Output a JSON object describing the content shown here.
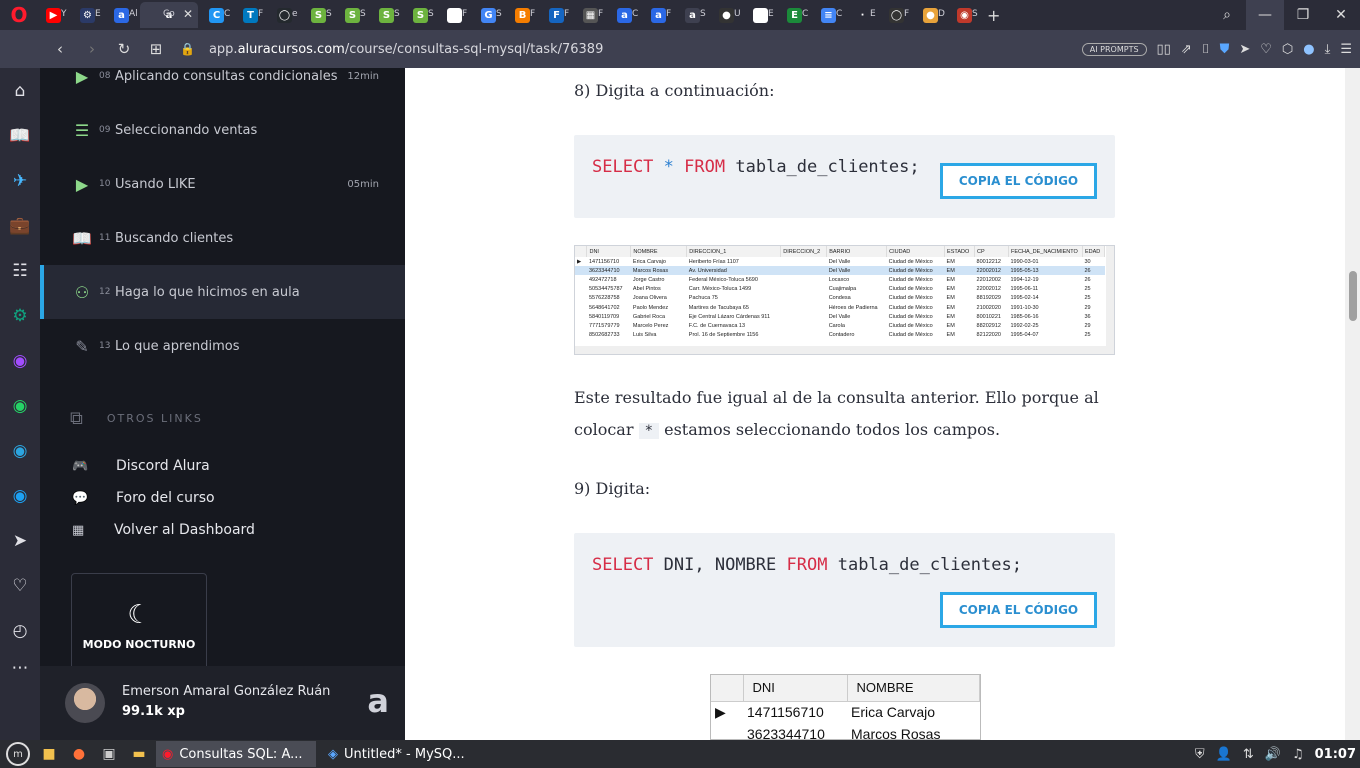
{
  "browser": {
    "tabs": [
      {
        "favicon": "▶",
        "color": "#ff0000",
        "title": "Y"
      },
      {
        "favicon": "⚙",
        "color": "#2b3a67",
        "title": "E"
      },
      {
        "favicon": "a",
        "color": "#2b68e5",
        "title": "Al"
      },
      {
        "favicon": "a",
        "color": "#3e4050",
        "title": "Co",
        "active": true
      },
      {
        "favicon": "C",
        "color": "#2196f3",
        "title": "C"
      },
      {
        "favicon": "T",
        "color": "#0079bf",
        "title": "F"
      },
      {
        "favicon": "◯",
        "color": "#24292e",
        "title": "e"
      },
      {
        "favicon": "S",
        "color": "#6db33f",
        "title": "S"
      },
      {
        "favicon": "S",
        "color": "#6db33f",
        "title": "S"
      },
      {
        "favicon": "S",
        "color": "#6db33f",
        "title": "S"
      },
      {
        "favicon": "S",
        "color": "#6db33f",
        "title": "S"
      },
      {
        "favicon": "□",
        "color": "#ffffff",
        "title": "F"
      },
      {
        "favicon": "G",
        "color": "#4285f4",
        "title": "S"
      },
      {
        "favicon": "B",
        "color": "#f57d00",
        "title": "F"
      },
      {
        "favicon": "F",
        "color": "#1565c0",
        "title": "F"
      },
      {
        "favicon": "▦",
        "color": "#555555",
        "title": "F"
      },
      {
        "favicon": "a",
        "color": "#2b68e5",
        "title": "C"
      },
      {
        "favicon": "a",
        "color": "#2b68e5",
        "title": "F"
      },
      {
        "favicon": "a",
        "color": "#3e4050",
        "title": "S"
      },
      {
        "favicon": "●",
        "color": "#333333",
        "title": "U"
      },
      {
        "favicon": "W",
        "color": "#ffffff",
        "title": "E"
      },
      {
        "favicon": "E",
        "color": "#1b8a3a",
        "title": "C"
      },
      {
        "favicon": "≡",
        "color": "#4285f4",
        "title": "C"
      },
      {
        "favicon": "·",
        "color": "#2b2c38",
        "title": "E"
      },
      {
        "favicon": "◯",
        "color": "#333333",
        "title": "F"
      },
      {
        "favicon": "●",
        "color": "#e8a33b",
        "title": "D"
      },
      {
        "favicon": "◉",
        "color": "#c0392b",
        "title": "S"
      }
    ],
    "url_prefix": "app.",
    "url_domain": "aluracursos.com",
    "url_path": "/course/consultas-sql-mysql/task/76389",
    "ai_prompts_label": "AI PROMPTS"
  },
  "course_sidebar": {
    "lessons": [
      {
        "num": "08",
        "title": "Aplicando consultas condicionales",
        "duration": "12min",
        "icon": "video-icon",
        "glyph": "▶"
      },
      {
        "num": "09",
        "title": "Seleccionando ventas",
        "duration": "",
        "icon": "list-icon",
        "glyph": "☰"
      },
      {
        "num": "10",
        "title": "Usando LIKE",
        "duration": "05min",
        "icon": "video-icon",
        "glyph": "▶"
      },
      {
        "num": "11",
        "title": "Buscando clientes",
        "duration": "",
        "icon": "book-icon",
        "glyph": "📖"
      },
      {
        "num": "12",
        "title": "Haga lo que hicimos en aula",
        "duration": "",
        "icon": "practice-icon",
        "glyph": "⚇"
      },
      {
        "num": "13",
        "title": "Lo que aprendimos",
        "duration": "",
        "icon": "learned-icon",
        "glyph": "✎"
      }
    ],
    "otros_links_label": "OTROS LINKS",
    "links": [
      {
        "label": "Discord Alura",
        "icon": "discord-icon"
      },
      {
        "label": "Foro del curso",
        "icon": "forum-icon"
      },
      {
        "label": "Volver al Dashboard",
        "icon": "dashboard-icon"
      }
    ],
    "night_mode_label": "MODO NOCTURNO",
    "user": {
      "name": "Emerson Amaral González Ruán",
      "xp": "99.1k xp"
    }
  },
  "content": {
    "step8": "8) Digita a continuación:",
    "code1": {
      "kw1": "SELECT",
      "star": "*",
      "kw2": "FROM",
      "rest": "tabla_de_clientes;"
    },
    "copy_label": "COPIA EL CÓDIGO",
    "para_before": "Este resultado fue igual al de la consulta anterior. Ello porque al colocar",
    "para_code": "*",
    "para_after": "estamos seleccionando todos los campos.",
    "step9": "9) Digita:",
    "code2": {
      "kw1": "SELECT",
      "cols": "DNI, NOMBRE",
      "kw2": "FROM",
      "rest": "tabla_de_clientes;"
    }
  },
  "result_table_1": {
    "headers": [
      "",
      "DNI",
      "NOMBRE",
      "DIRECCION_1",
      "DIRECCION_2",
      "BARRIO",
      "CIUDAD",
      "ESTADO",
      "CP",
      "FECHA_DE_NACIMIENTO",
      "EDAD"
    ],
    "rows": [
      [
        "▶",
        "1471156710",
        "Erica Carvajo",
        "Heriberto Frías 1107",
        "",
        "Del Valle",
        "Ciudad de México",
        "EM",
        "80012212",
        "1990-03-01",
        "30"
      ],
      [
        "",
        "3623344710",
        "Marcos Rosas",
        "Av. Universidad",
        "",
        "Del Valle",
        "Ciudad de México",
        "EM",
        "22002012",
        "1995-05-13",
        "26"
      ],
      [
        "",
        "492472718",
        "Jorge Castro",
        "Federal México-Toluca 5690",
        "",
        "Locaxco",
        "Ciudad de México",
        "EM",
        "22012002",
        "1994-12-19",
        "26"
      ],
      [
        "",
        "50534475787",
        "Abel Pintos",
        "Carr. México-Toluca 1499",
        "",
        "Cuajimalpa",
        "Ciudad de México",
        "EM",
        "22002012",
        "1995-06-11",
        "25"
      ],
      [
        "",
        "5576228758",
        "Joana Olivera",
        "Pachuca 75",
        "",
        "Condesa",
        "Ciudad de México",
        "EM",
        "88192029",
        "1995-02-14",
        "25"
      ],
      [
        "",
        "5648641702",
        "Paolo Mendez",
        "Martires de Tacubaya 65",
        "",
        "Héroes de Padierna",
        "Ciudad de México",
        "EM",
        "21002020",
        "1991-10-30",
        "29"
      ],
      [
        "",
        "5840119709",
        "Gabriel Roca",
        "Eje Central Lázaro Cárdenas 911",
        "",
        "Del Valle",
        "Ciudad de México",
        "EM",
        "80010221",
        "1985-06-16",
        "36"
      ],
      [
        "",
        "7771579779",
        "Marcelo Perez",
        "F.C. de Cuernavaca 13",
        "",
        "Carola",
        "Ciudad de México",
        "EM",
        "88202912",
        "1992-02-25",
        "29"
      ],
      [
        "",
        "8502682733",
        "Luis Silva",
        "Prol. 16 de Septiembre 1156",
        "",
        "Contadero",
        "Ciudad de México",
        "EM",
        "82122020",
        "1995-04-07",
        "25"
      ]
    ]
  },
  "result_table_2": {
    "headers": [
      "",
      "DNI",
      "NOMBRE"
    ],
    "rows": [
      [
        "▶",
        "1471156710",
        "Erica Carvajo"
      ],
      [
        "",
        "3623344710",
        "Marcos Rosas"
      ]
    ]
  },
  "taskbar": {
    "windows": [
      {
        "label": "Consultas SQL: A...",
        "active": true,
        "icon": "opera-icon"
      },
      {
        "label": "Untitled* - MySQ...",
        "active": false,
        "icon": "mysql-workbench-icon"
      }
    ],
    "clock": "01:07"
  }
}
